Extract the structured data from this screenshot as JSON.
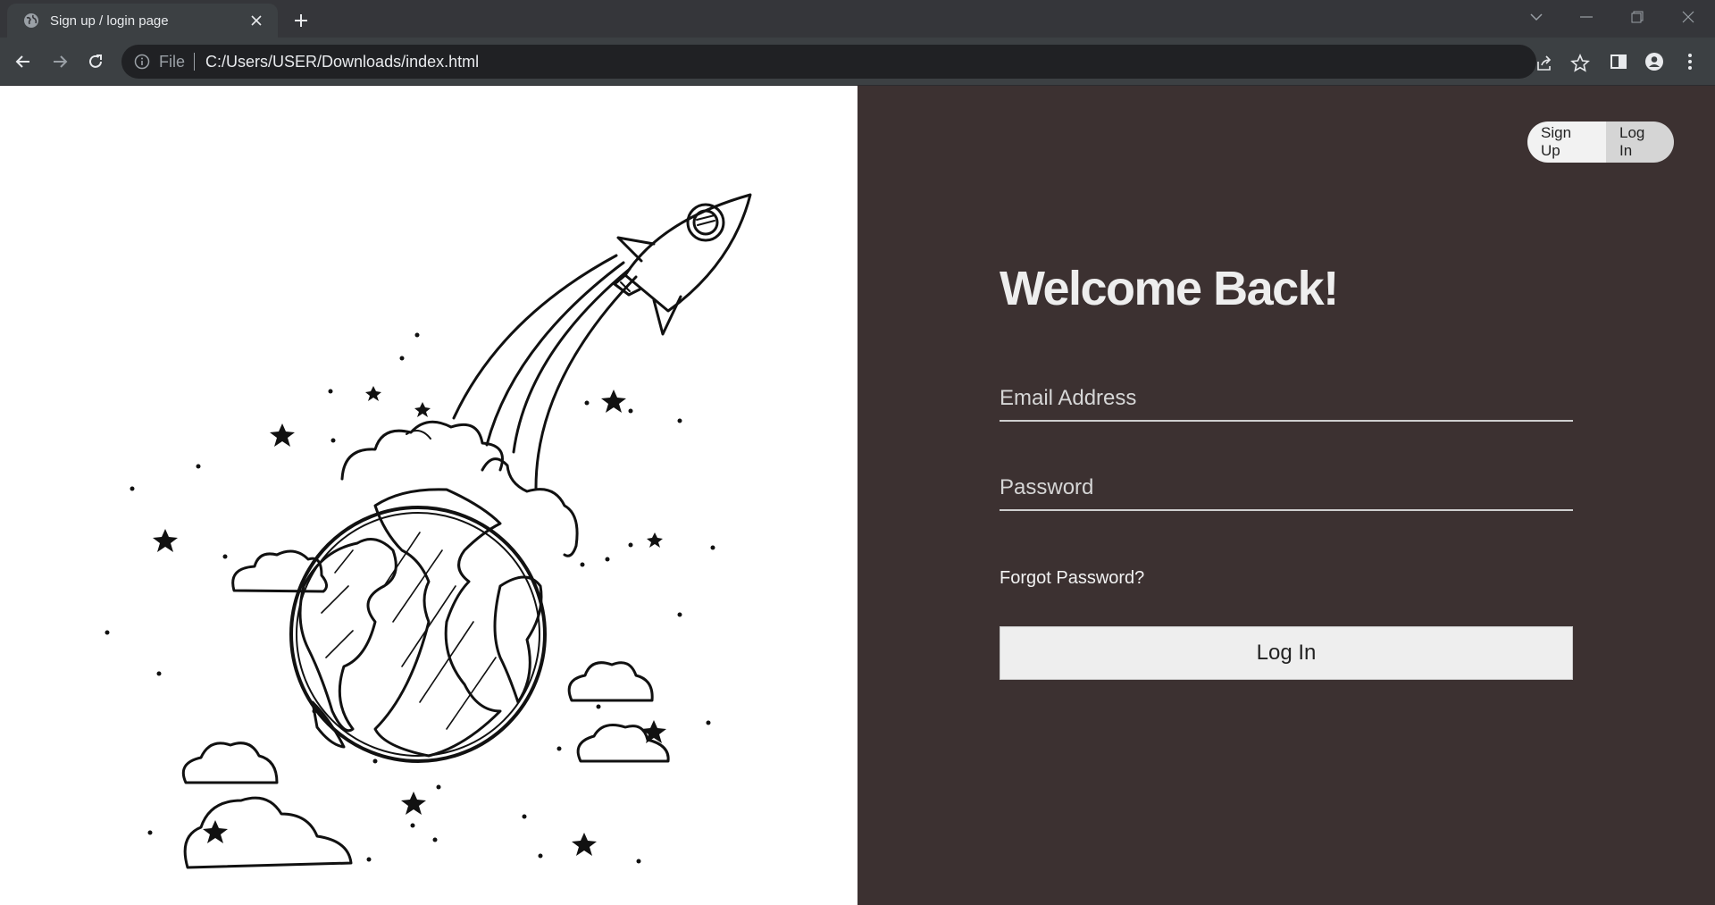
{
  "browser": {
    "tab_title": "Sign up / login page",
    "address_scheme": "File",
    "address_url": "C:/Users/USER/Downloads/index.html"
  },
  "auth_toggle": {
    "signup_label": "Sign Up",
    "login_label": "Log In",
    "active": "Log In"
  },
  "form": {
    "heading": "Welcome Back!",
    "email_placeholder": "Email Address",
    "password_placeholder": "Password",
    "forgot_label": "Forgot Password?",
    "submit_label": "Log In"
  },
  "colors": {
    "right_panel_bg": "#3c3131",
    "left_panel_bg": "#ffffff",
    "button_bg": "#eeeeee"
  },
  "illustration": {
    "icon": "rocket-launching-from-earth-illustration"
  }
}
